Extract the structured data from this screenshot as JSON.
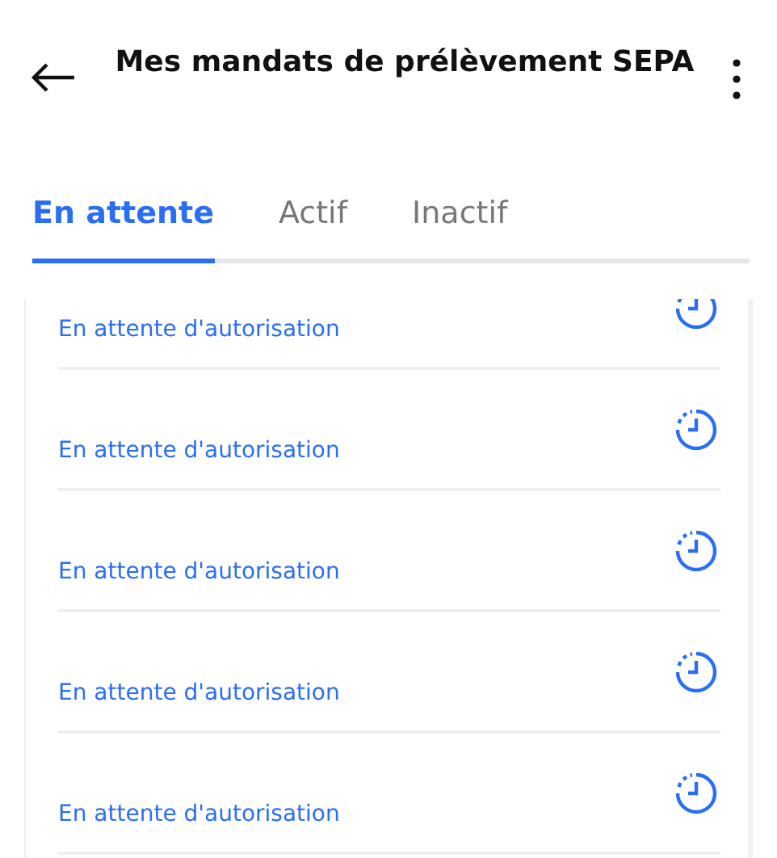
{
  "header": {
    "title": "Mes mandats de prélèvement SEPA"
  },
  "tabs": [
    {
      "label": "En attente",
      "selected": true
    },
    {
      "label": "Actif",
      "selected": false
    },
    {
      "label": "Inactif",
      "selected": false
    }
  ],
  "mandates": [
    {
      "status": "En attente d'autorisation"
    },
    {
      "status": "En attente d'autorisation"
    },
    {
      "status": "En attente d'autorisation"
    },
    {
      "status": "En attente d'autorisation"
    },
    {
      "status": "En attente d'autorisation"
    }
  ]
}
